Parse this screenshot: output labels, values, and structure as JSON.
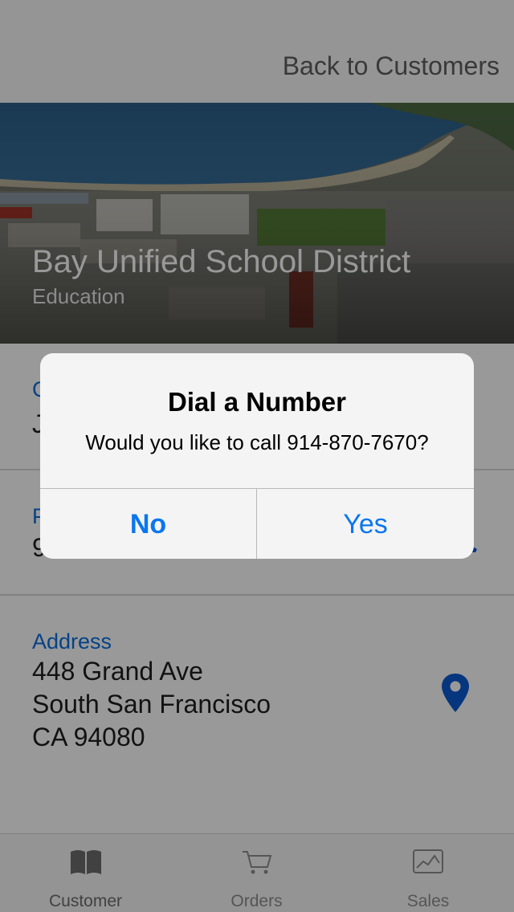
{
  "navbar": {
    "back_label": "Back to Customers"
  },
  "customer": {
    "name": "Bay Unified School District",
    "category": "Education"
  },
  "sections": {
    "contact": {
      "label": "C",
      "value": "J"
    },
    "phone": {
      "label": "P",
      "value": "9"
    },
    "address": {
      "label": "Address",
      "line1": "448 Grand Ave",
      "line2": "South San Francisco",
      "line3": "CA 94080"
    }
  },
  "tabs": [
    {
      "label": "Customer",
      "icon": "book-icon"
    },
    {
      "label": "Orders",
      "icon": "cart-icon"
    },
    {
      "label": "Sales",
      "icon": "chart-icon"
    }
  ],
  "alert": {
    "title": "Dial a Number",
    "message": "Would you like to call 914-870-7670?",
    "no_label": "No",
    "yes_label": "Yes"
  },
  "colors": {
    "accent": "#0a76f0",
    "label_blue": "#0a6ee0",
    "pin_blue": "#0a5ad2"
  }
}
